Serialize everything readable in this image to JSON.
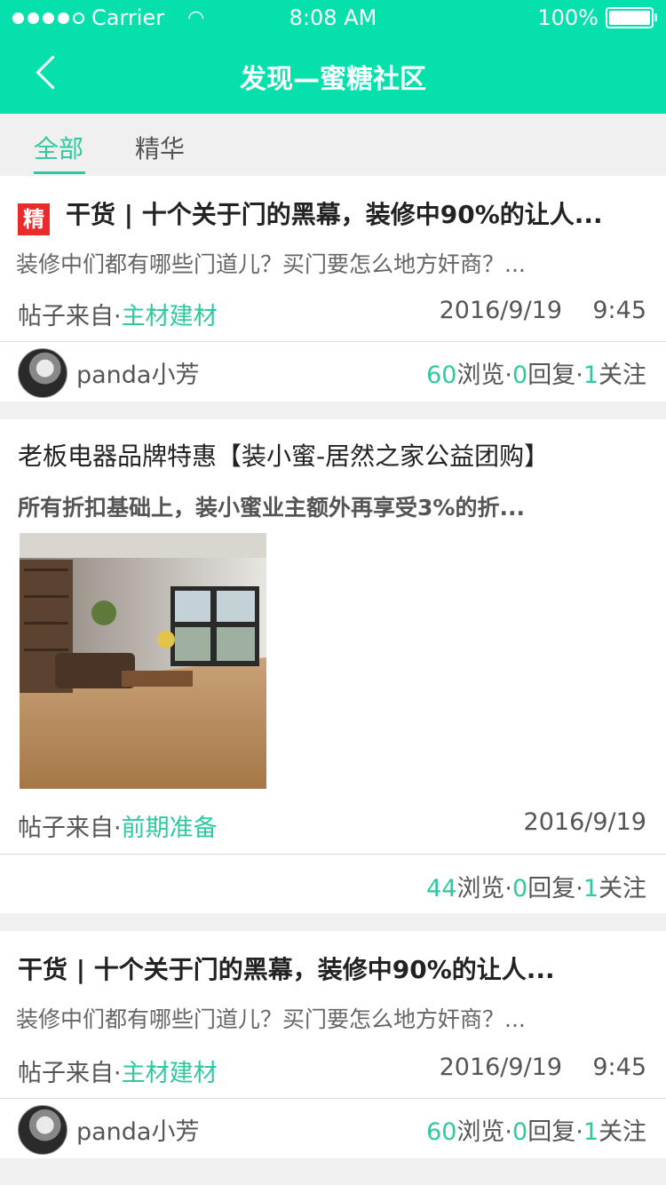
{
  "status_bar": {
    "carrier": "Carrier",
    "time": "8:08 AM",
    "battery": "100%"
  },
  "header": {
    "title": "发现—蜜糖社区"
  },
  "tabs": [
    {
      "label": "全部"
    },
    {
      "label": "精华"
    }
  ],
  "posts": [
    {
      "badge": "精",
      "title": "干货 | 十个关于门的黑幕，装修中90%的让人...",
      "summary": "装修中们都有哪些门道儿？买门要怎么地方奸商？...",
      "source_prefix": "帖子来自·",
      "source": "主材建材",
      "date": "2016/9/19    9:45",
      "author": "panda小芳",
      "views": "60",
      "views_label": "浏览·",
      "replies": "0",
      "replies_label": "回复·",
      "follows": "1",
      "follows_label": "关注"
    },
    {
      "title": "老板电器品牌特惠【装小蜜-居然之家公益团购】",
      "summary": "所有折扣基础上，装小蜜业主额外再享受3%的折...",
      "source_prefix": "帖子来自·",
      "source": "前期准备",
      "date": "2016/9/19",
      "views": "44",
      "views_label": "浏览·",
      "replies": "0",
      "replies_label": "回复·",
      "follows": "1",
      "follows_label": "关注"
    },
    {
      "title": "干货 | 十个关于门的黑幕，装修中90%的让人...",
      "summary": "装修中们都有哪些门道儿？买门要怎么地方奸商？...",
      "source_prefix": "帖子来自·",
      "source": "主材建材",
      "date": "2016/9/19    9:45",
      "author": "panda小芳",
      "views": "60",
      "views_label": "浏览·",
      "replies": "0",
      "replies_label": "回复·",
      "follows": "1",
      "follows_label": "关注"
    }
  ],
  "colors": {
    "brand": "#05e0ac",
    "accent": "#2ec99f",
    "badge": "#e92b2b"
  }
}
